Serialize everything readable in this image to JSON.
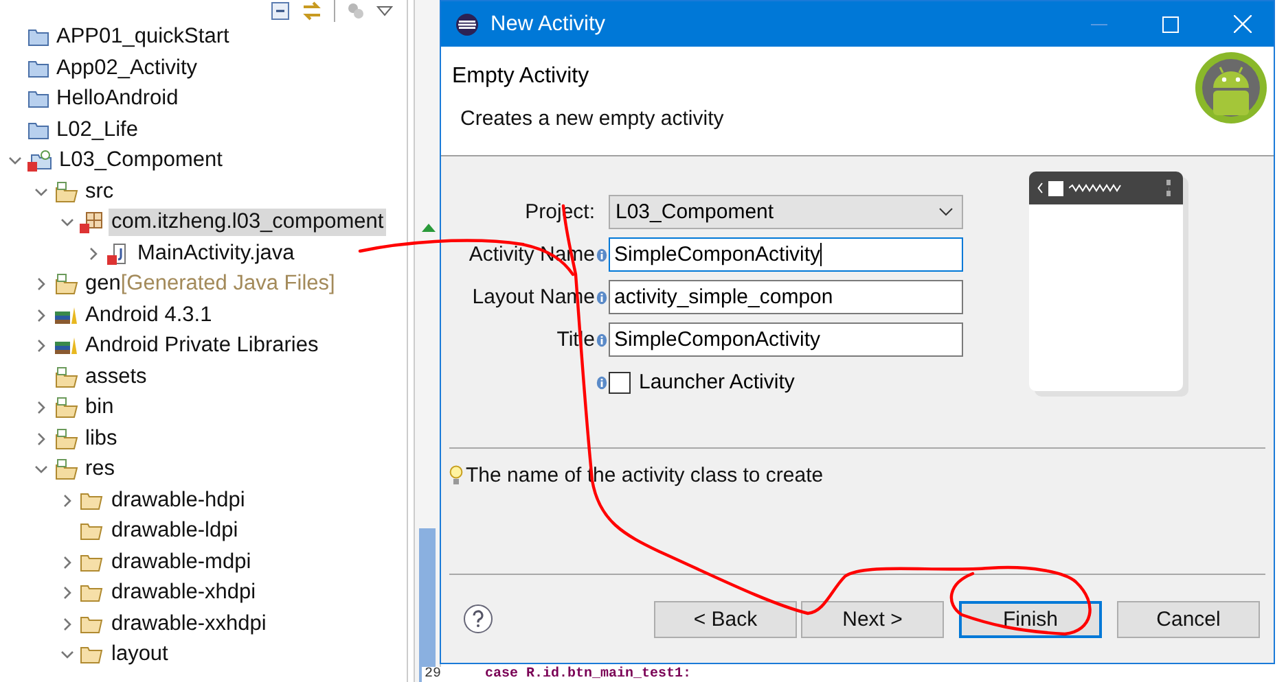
{
  "explorer": {
    "tree": [
      {
        "label": "APP01_quickStart",
        "kind": "project",
        "selected": false
      },
      {
        "label": "App02_Activity",
        "kind": "project",
        "selected": false
      },
      {
        "label": "HelloAndroid",
        "kind": "project",
        "selected": false
      },
      {
        "label": "L02_Life",
        "kind": "project",
        "selected": false
      },
      {
        "label": "L03_Compoment",
        "kind": "android-project",
        "expanded": true,
        "selected": false,
        "children": [
          {
            "label": "src",
            "kind": "source-folder",
            "expanded": true,
            "selected": false,
            "children": [
              {
                "label": "com.itzheng.l03_compoment",
                "kind": "package",
                "expanded": true,
                "selected": true,
                "children": [
                  {
                    "label": "MainActivity.java",
                    "kind": "java-file",
                    "expanded": false,
                    "selected": false
                  }
                ]
              }
            ]
          },
          {
            "label": "gen",
            "decoration": "[Generated Java Files]",
            "kind": "source-folder",
            "expanded": false,
            "selected": false
          },
          {
            "label": "Android 4.3.1",
            "kind": "library",
            "expanded": false,
            "selected": false
          },
          {
            "label": "Android Private Libraries",
            "kind": "library",
            "expanded": false,
            "selected": false
          },
          {
            "label": "assets",
            "kind": "source-folder",
            "selected": false
          },
          {
            "label": "bin",
            "kind": "source-folder",
            "expanded": false,
            "selected": false
          },
          {
            "label": "libs",
            "kind": "source-folder",
            "expanded": false,
            "selected": false
          },
          {
            "label": "res",
            "kind": "source-folder",
            "expanded": true,
            "selected": false,
            "children": [
              {
                "label": "drawable-hdpi",
                "kind": "folder",
                "expanded": false,
                "selected": false
              },
              {
                "label": "drawable-ldpi",
                "kind": "folder",
                "selected": false
              },
              {
                "label": "drawable-mdpi",
                "kind": "folder",
                "expanded": false,
                "selected": false
              },
              {
                "label": "drawable-xhdpi",
                "kind": "folder",
                "expanded": false,
                "selected": false
              },
              {
                "label": "drawable-xxhdpi",
                "kind": "folder",
                "expanded": false,
                "selected": false
              },
              {
                "label": "layout",
                "kind": "folder",
                "expanded": true,
                "selected": false
              }
            ]
          }
        ]
      }
    ]
  },
  "editor": {
    "line_number": "29",
    "code": "case R.id.btn_main_test1:"
  },
  "dialog": {
    "title": "New Activity",
    "heading": "Empty Activity",
    "description": "Creates a new empty activity",
    "fields": [
      {
        "label": "Project:",
        "kind": "dropdown",
        "value": "L03_Compoment"
      },
      {
        "label": "Activity Name",
        "kind": "text",
        "value": "SimpleComponActivity",
        "info": true,
        "focused": true
      },
      {
        "label": "Layout Name",
        "kind": "text",
        "value": "activity_simple_compon",
        "info": true,
        "focused": false
      },
      {
        "label": "Title",
        "kind": "text",
        "value": "SimpleComponActivity",
        "info": true,
        "focused": false
      },
      {
        "label": "Launcher Activity",
        "kind": "checkbox",
        "checked": false,
        "info": true
      }
    ],
    "hint": "The name of the activity class to create",
    "buttons": [
      {
        "label": "< Back",
        "default": false
      },
      {
        "label": "Next >",
        "default": false
      },
      {
        "label": "Finish",
        "default": true
      },
      {
        "label": "Cancel",
        "default": false
      }
    ]
  }
}
